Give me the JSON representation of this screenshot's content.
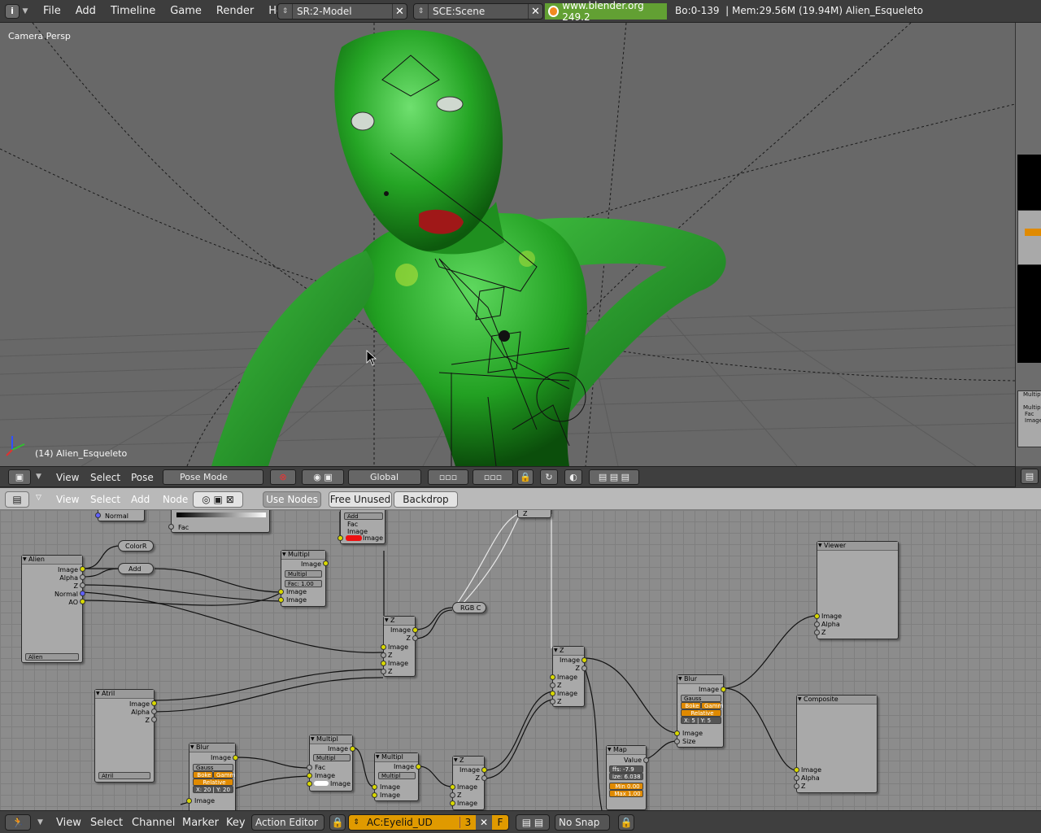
{
  "top_header": {
    "menus": [
      "File",
      "Add",
      "Timeline",
      "Game",
      "Render",
      "Help"
    ],
    "screen_field": "SR:2-Model",
    "scene_field": "SCE:Scene",
    "url": "www.blender.org 249.2",
    "stats": "Bo:0-139  | Mem:29.56M (19.94M) Alien_Esqueleto"
  },
  "viewport": {
    "view_label": "Camera Persp",
    "object_label": "(14) Alien_Esqueleto"
  },
  "view3d_header": {
    "menus": [
      "View",
      "Select",
      "Pose"
    ],
    "mode": "Pose Mode",
    "orientation": "Global"
  },
  "node_header": {
    "menus": [
      "View",
      "Select",
      "Add",
      "Node"
    ],
    "use_nodes": "Use Nodes",
    "free_unused": "Free Unused",
    "backdrop": "Backdrop"
  },
  "nodes": {
    "normal_frag": "Normal",
    "fac_frag": "Fac",
    "add_top": {
      "field": "Add",
      "fac": "Fac",
      "image": "Image",
      "image2": "Image"
    },
    "z_top": "Z",
    "alien": {
      "title": "Alien",
      "outputs": [
        "Image",
        "Alpha",
        "Z",
        "Normal",
        "AO"
      ],
      "select": "Alien"
    },
    "colorr": "ColorR",
    "add_small": "Add",
    "multiply1": {
      "title": "Multipl",
      "out": "Image",
      "mode": "Multipl",
      "fac": "Fac: 1.00",
      "in": [
        "Image",
        "Image"
      ]
    },
    "zcombine1": {
      "title": "Z",
      "outs": [
        "Image",
        "Z"
      ],
      "ins": [
        "Image",
        "Z",
        "Image",
        "Z"
      ]
    },
    "rgbc": "RGB C",
    "atril": {
      "title": "Atril",
      "outputs": [
        "Image",
        "Alpha",
        "Z"
      ],
      "select": "Atril"
    },
    "blur1": {
      "title": "Blur",
      "out": "Image",
      "gauss": "Gauss",
      "bokeh": "Boke",
      "gamma": "Gamm",
      "relative": "Relative",
      "xy": "X: 20 | Y: 20",
      "in": "Image"
    },
    "multiply2": {
      "title": "Multipl",
      "out": "Image",
      "mode": "Multipl",
      "ins": [
        "Fac",
        "Image",
        "Image"
      ]
    },
    "multiply3": {
      "title": "Multipl",
      "out": "Image",
      "mode": "Multipl",
      "ins": [
        "Image",
        "Image"
      ]
    },
    "zcombine2": {
      "title": "Z",
      "outs": [
        "Image",
        "Z"
      ],
      "ins": [
        "Image",
        "Z",
        "Image"
      ]
    },
    "zcombine3": {
      "title": "Z",
      "outs": [
        "Image",
        "Z"
      ],
      "ins": [
        "Image",
        "Z",
        "Image",
        "Z"
      ]
    },
    "map": {
      "title": "Map",
      "out": "Value",
      "offs": "ffs: -7.9",
      "size": "ize: 6.038",
      "min": "Min 0.00",
      "max": "Max 1.00"
    },
    "blur2": {
      "title": "Blur",
      "out": "Image",
      "gauss": "Gauss",
      "bokeh": "Boke",
      "gamma": "Gamm",
      "relative": "Relative",
      "xy": "X: 5 | Y: 5",
      "ins": [
        "Image",
        "Size"
      ]
    },
    "viewer": {
      "title": "Viewer",
      "ins": [
        "Image",
        "Alpha",
        "Z"
      ]
    },
    "composite": {
      "title": "Composite",
      "ins": [
        "Image",
        "Alpha",
        "Z"
      ]
    },
    "side_multiply": {
      "title": "Multipl",
      "mode": "Multipl",
      "ins": [
        "Fac",
        "Image",
        "Image"
      ]
    }
  },
  "action_header": {
    "menus": [
      "View",
      "Select",
      "Channel",
      "Marker",
      "Key"
    ],
    "editor": "Action Editor",
    "action": "AC:Eyelid_UD",
    "users": "3",
    "fake_user": "F",
    "snap": "No Snap"
  },
  "colors": {
    "alien_green": "#2ea82e",
    "viewport_bg": "#686868",
    "node_bg": "#8c8c8c",
    "socket_yellow": "#d8d800",
    "accent_orange": "#e08a00"
  }
}
